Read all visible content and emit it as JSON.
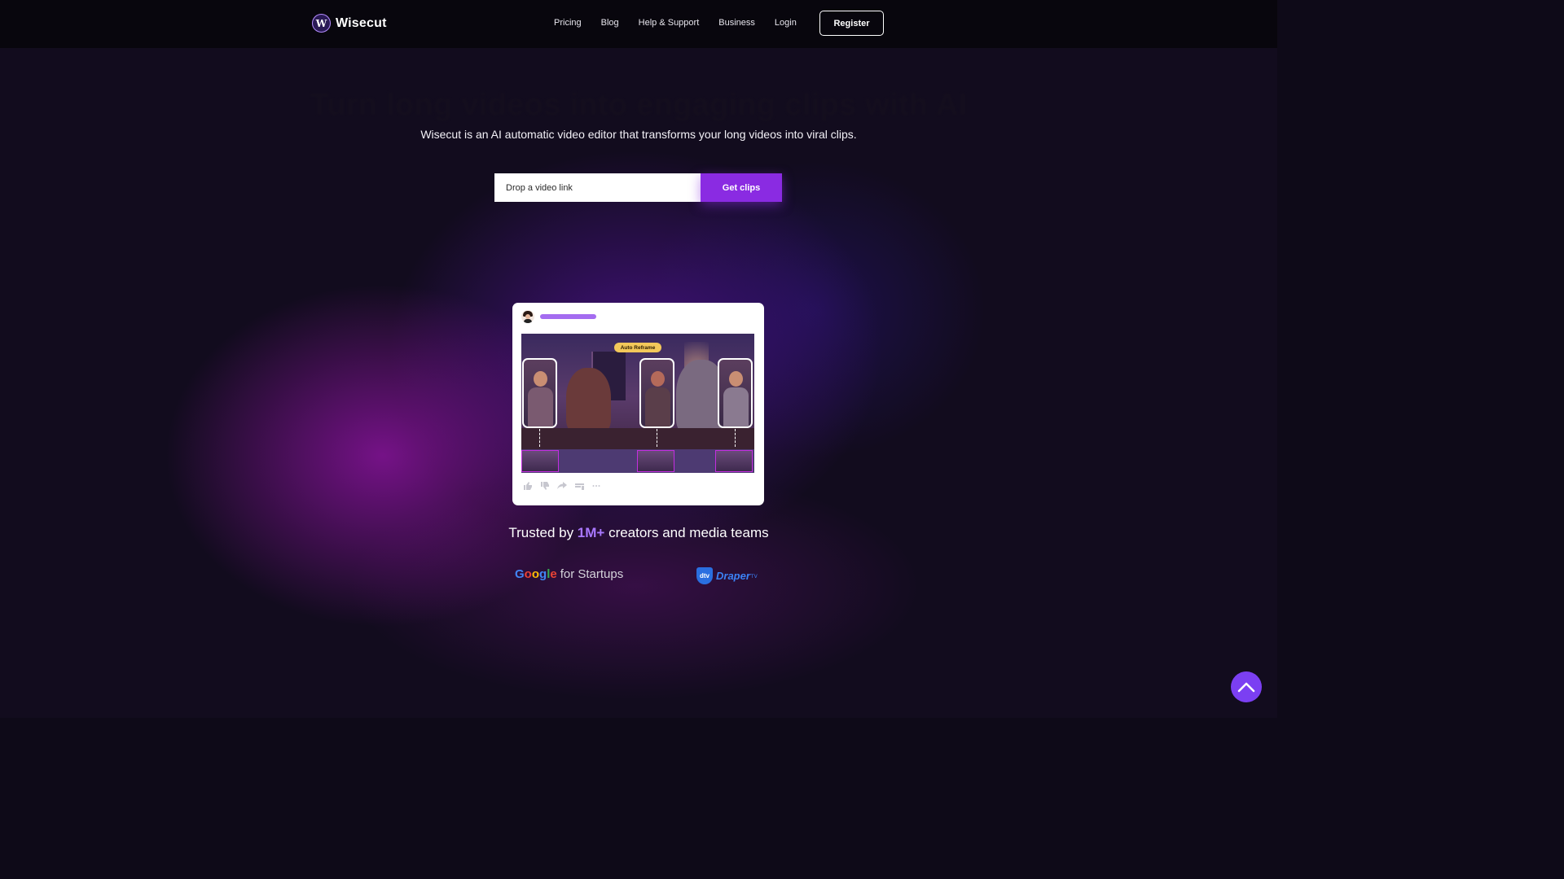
{
  "nav": {
    "logo_mark": "W",
    "logo_text": "Wisecut",
    "links": [
      "Pricing",
      "Blog",
      "Help & Support",
      "Business",
      "Login"
    ],
    "register_label": "Register"
  },
  "hero": {
    "headline": "Turn long videos into engaging clips with AI",
    "subtitle": "Wisecut is an AI automatic video editor that transforms your long videos into viral clips.",
    "input_placeholder": "Drop a video link",
    "cta_label": "Get clips"
  },
  "preview": {
    "badge": "Auto Reframe",
    "action_icons": [
      "thumbs-up-icon",
      "thumbs-down-icon",
      "share-icon",
      "save-icon",
      "more-icon"
    ]
  },
  "trusted": {
    "prefix": "Trusted by ",
    "highlight": "1M+",
    "suffix": " creators and media teams"
  },
  "partners": {
    "google_letters": [
      "G",
      "o",
      "o",
      "g",
      "l",
      "e"
    ],
    "google_suffix": "for Startups",
    "draper_mark": "dtv",
    "draper_name": "Draper",
    "draper_sup": "TV"
  },
  "colors": {
    "accent": "#8a2be2",
    "highlight": "#a978ff",
    "badge": "#f3c85a",
    "scroll_button": "#7b3ff2"
  }
}
